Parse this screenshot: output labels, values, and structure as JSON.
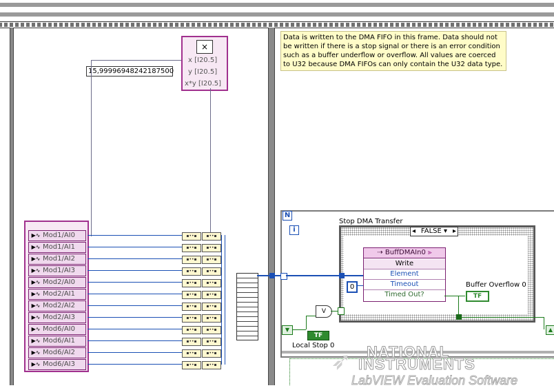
{
  "comment": {
    "text": "Data is written to the DMA FIFO in this frame.  Data should not be written if there is a stop signal or there is an error condition such as a buffer underflow or overflow.   All values are coerced to U32 because DMA FIFOs can only contain the U32 data type."
  },
  "constant": {
    "value": "15,99996948242187500"
  },
  "multiply": {
    "icon": "×",
    "x": "x [I20.5]",
    "y": "y [I20.5]",
    "xy": "x*y [I20.5]"
  },
  "channels": [
    "Mod1/AI0",
    "Mod1/AI1",
    "Mod1/AI2",
    "Mod1/AI3",
    "Mod2/AI0",
    "Mod2/AI1",
    "Mod2/AI2",
    "Mod2/AI3",
    "Mod6/AI0",
    "Mod6/AI1",
    "Mod6/AI2",
    "Mod6/AI3"
  ],
  "loop": {
    "n_label": "N",
    "i_label": "i"
  },
  "case": {
    "title": "Stop DMA Transfer",
    "selector": "FALSE"
  },
  "fifo": {
    "name": "BuffDMAIn0",
    "write": "Write",
    "element": "Element",
    "timeout": "Timeout",
    "timed_out": "Timed Out?"
  },
  "timeout_const": "0",
  "buffer_overflow": {
    "label": "Buffer Overflow 0",
    "indicator": "TF"
  },
  "local_stop": {
    "label": "Local Stop 0",
    "control": "TF"
  },
  "or_gate": "V",
  "watermark": {
    "line1": "NATIONAL",
    "line2": "INSTRUMENTS",
    "line3": "LabVIEW Evaluation Software"
  }
}
